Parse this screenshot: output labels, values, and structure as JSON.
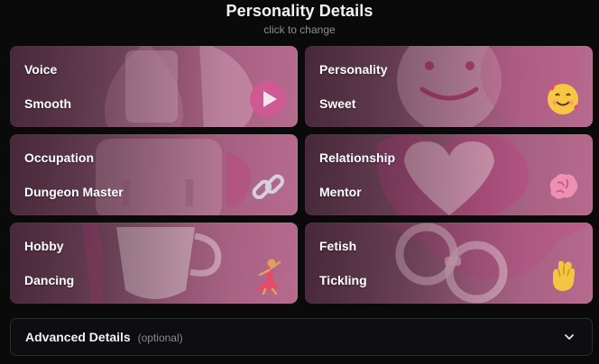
{
  "header": {
    "title": "Personality Details",
    "subtitle": "click to change"
  },
  "cards": [
    {
      "label": "Voice",
      "value": "Smooth",
      "icon": "play-icon"
    },
    {
      "label": "Personality",
      "value": "Sweet",
      "icon": "smiling-face-with-hearts-icon"
    },
    {
      "label": "Occupation",
      "value": "Dungeon Master",
      "icon": "link-icon"
    },
    {
      "label": "Relationship",
      "value": "Mentor",
      "icon": "brain-icon"
    },
    {
      "label": "Hobby",
      "value": "Dancing",
      "icon": "woman-dancing-icon"
    },
    {
      "label": "Fetish",
      "value": "Tickling",
      "icon": "hand-gesture-icon"
    }
  ],
  "advanced": {
    "title": "Advanced Details",
    "optional": "(optional)",
    "icon": "chevron-down-icon"
  },
  "colors": {
    "background": "#0a0a0b",
    "card": "#9a5a79",
    "accent": "#c24a86"
  }
}
